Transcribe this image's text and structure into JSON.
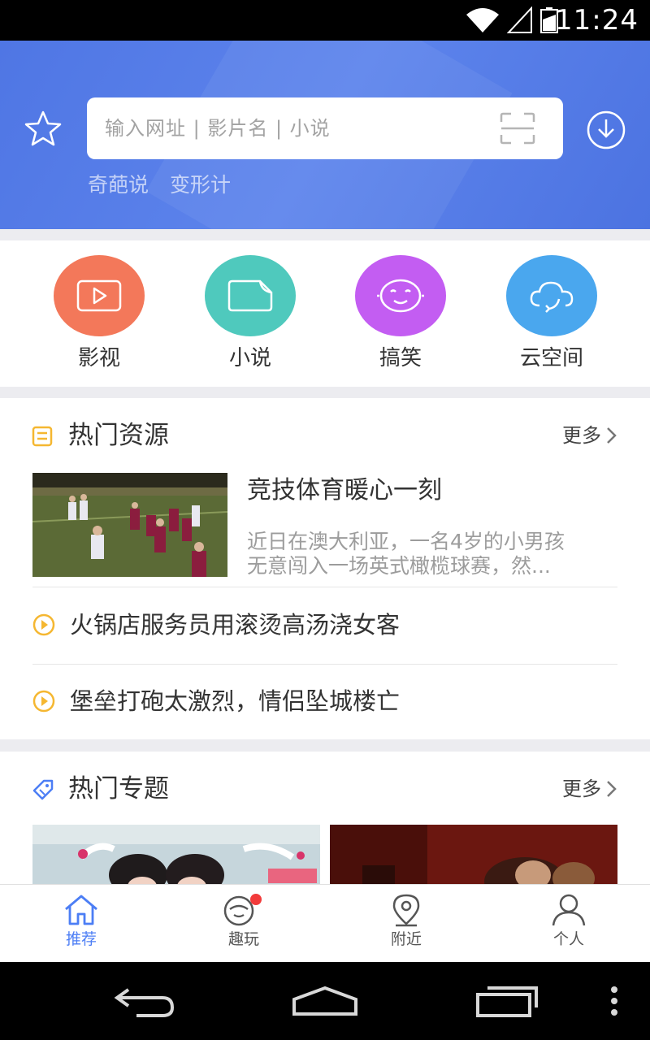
{
  "status_bar": {
    "time": "11:24",
    "icons": [
      "wifi-icon",
      "signal-icon",
      "battery-icon"
    ]
  },
  "header": {
    "search_placeholder": "输入网址 | 影片名 | 小说",
    "hot_words": [
      "奇葩说",
      "变形计"
    ],
    "icons": {
      "favorite": "star-icon",
      "scan": "scan-icon",
      "download": "download-icon"
    }
  },
  "categories": [
    {
      "label": "影视",
      "color": "#f3785a",
      "icon": "video-icon"
    },
    {
      "label": "小说",
      "color": "#4fc9bd",
      "icon": "book-icon"
    },
    {
      "label": "搞笑",
      "color": "#c35df2",
      "icon": "smiley-icon"
    },
    {
      "label": "云空间",
      "color": "#4aa7ee",
      "icon": "cloud-icon"
    }
  ],
  "hot_resources": {
    "title": "热门资源",
    "more": "更多",
    "feature": {
      "title": "竞技体育暖心一刻",
      "desc_line1": "近日在澳大利亚，一名4岁的小男孩",
      "desc_line2": "无意闯入一场英式橄榄球赛，然..."
    },
    "items": [
      "火锅店服务员用滚烫高汤浇女客",
      "堡垒打砲太激烈，情侣坠城楼亡"
    ]
  },
  "hot_topics": {
    "title": "热门专题",
    "more": "更多"
  },
  "bottom_nav": [
    {
      "label": "推荐",
      "icon": "home-icon",
      "active": true
    },
    {
      "label": "趣玩",
      "icon": "fun-icon",
      "active": false
    },
    {
      "label": "附近",
      "icon": "location-icon",
      "active": false
    },
    {
      "label": "个人",
      "icon": "person-icon",
      "active": false
    }
  ],
  "colors": {
    "brand": "#5a80ea",
    "active_nav": "#4c7ef5",
    "accent_yellow": "#f5b731",
    "badge_red": "#f23b3b"
  }
}
